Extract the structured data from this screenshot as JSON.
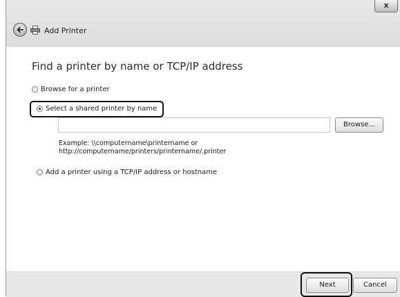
{
  "window": {
    "title": "Add Printer",
    "close_label": "x"
  },
  "content": {
    "heading": "Find a printer by name or TCP/IP address",
    "options": [
      {
        "label": "Browse for a printer",
        "selected": false
      },
      {
        "label": "Select a shared printer by name",
        "selected": true
      },
      {
        "label": "Add a printer using a TCP/IP address or hostname",
        "selected": false
      }
    ],
    "printer_name": {
      "value": "",
      "placeholder": ""
    },
    "browse_label": "Browse...",
    "example_line1": "Example: \\\\computername\\printername or",
    "example_line2": "http://computername/printers/printername/.printer"
  },
  "footer": {
    "next_label": "Next",
    "cancel_label": "Cancel"
  }
}
